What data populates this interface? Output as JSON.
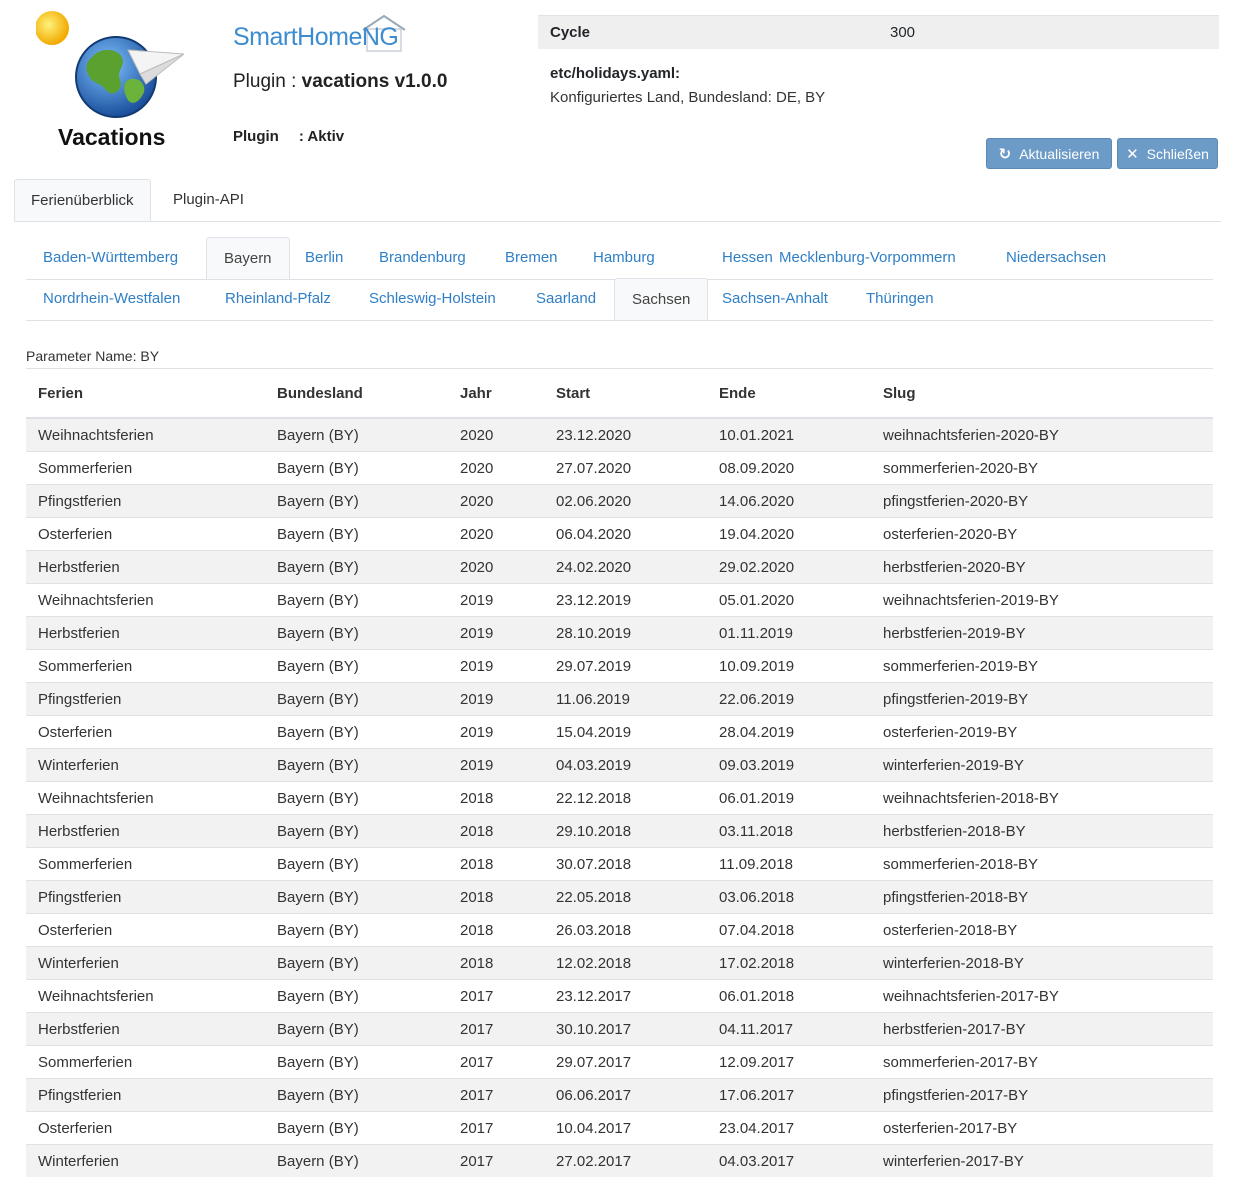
{
  "plugin_logo_name": "Vacations",
  "brand": "SmartHomeNG",
  "plugin_title_prefix": "Plugin : ",
  "plugin_title_name": "vacations v1.0.0",
  "plugin_state_label": "Plugin",
  "plugin_state_value": ": Aktiv",
  "info": {
    "cycle_label": "Cycle",
    "cycle_value": "300",
    "holidays_label": "etc/holidays.yaml:",
    "holidays_value": "Konfiguriertes Land, Bundesland: DE, BY"
  },
  "buttons": {
    "refresh": "Aktualisieren",
    "close": "Schließen"
  },
  "main_tabs": [
    "Ferienüberblick",
    "Plugin-API"
  ],
  "state_tabs_row1": [
    "Baden-Württemberg",
    "Bayern",
    "Berlin",
    "Brandenburg",
    "Bremen",
    "Hamburg",
    "Hessen",
    "Mecklenburg-Vorpommern",
    "Niedersachsen"
  ],
  "state_tabs_row2": [
    "Nordrhein-Westfalen",
    "Rheinland-Pfalz",
    "Schleswig-Holstein",
    "Saarland",
    "Sachsen",
    "Sachsen-Anhalt",
    "Thüringen"
  ],
  "param_name": "Parameter Name: BY",
  "table": {
    "headers": [
      "Ferien",
      "Bundesland",
      "Jahr",
      "Start",
      "Ende",
      "Slug"
    ],
    "rows": [
      [
        "Weihnachtsferien",
        "Bayern (BY)",
        "2020",
        "23.12.2020",
        "10.01.2021",
        "weihnachtsferien-2020-BY"
      ],
      [
        "Sommerferien",
        "Bayern (BY)",
        "2020",
        "27.07.2020",
        "08.09.2020",
        "sommerferien-2020-BY"
      ],
      [
        "Pfingstferien",
        "Bayern (BY)",
        "2020",
        "02.06.2020",
        "14.06.2020",
        "pfingstferien-2020-BY"
      ],
      [
        "Osterferien",
        "Bayern (BY)",
        "2020",
        "06.04.2020",
        "19.04.2020",
        "osterferien-2020-BY"
      ],
      [
        "Herbstferien",
        "Bayern (BY)",
        "2020",
        "24.02.2020",
        "29.02.2020",
        "herbstferien-2020-BY"
      ],
      [
        "Weihnachtsferien",
        "Bayern (BY)",
        "2019",
        "23.12.2019",
        "05.01.2020",
        "weihnachtsferien-2019-BY"
      ],
      [
        "Herbstferien",
        "Bayern (BY)",
        "2019",
        "28.10.2019",
        "01.11.2019",
        "herbstferien-2019-BY"
      ],
      [
        "Sommerferien",
        "Bayern (BY)",
        "2019",
        "29.07.2019",
        "10.09.2019",
        "sommerferien-2019-BY"
      ],
      [
        "Pfingstferien",
        "Bayern (BY)",
        "2019",
        "11.06.2019",
        "22.06.2019",
        "pfingstferien-2019-BY"
      ],
      [
        "Osterferien",
        "Bayern (BY)",
        "2019",
        "15.04.2019",
        "28.04.2019",
        "osterferien-2019-BY"
      ],
      [
        "Winterferien",
        "Bayern (BY)",
        "2019",
        "04.03.2019",
        "09.03.2019",
        "winterferien-2019-BY"
      ],
      [
        "Weihnachtsferien",
        "Bayern (BY)",
        "2018",
        "22.12.2018",
        "06.01.2019",
        "weihnachtsferien-2018-BY"
      ],
      [
        "Herbstferien",
        "Bayern (BY)",
        "2018",
        "29.10.2018",
        "03.11.2018",
        "herbstferien-2018-BY"
      ],
      [
        "Sommerferien",
        "Bayern (BY)",
        "2018",
        "30.07.2018",
        "11.09.2018",
        "sommerferien-2018-BY"
      ],
      [
        "Pfingstferien",
        "Bayern (BY)",
        "2018",
        "22.05.2018",
        "03.06.2018",
        "pfingstferien-2018-BY"
      ],
      [
        "Osterferien",
        "Bayern (BY)",
        "2018",
        "26.03.2018",
        "07.04.2018",
        "osterferien-2018-BY"
      ],
      [
        "Winterferien",
        "Bayern (BY)",
        "2018",
        "12.02.2018",
        "17.02.2018",
        "winterferien-2018-BY"
      ],
      [
        "Weihnachtsferien",
        "Bayern (BY)",
        "2017",
        "23.12.2017",
        "06.01.2018",
        "weihnachtsferien-2017-BY"
      ],
      [
        "Herbstferien",
        "Bayern (BY)",
        "2017",
        "30.10.2017",
        "04.11.2017",
        "herbstferien-2017-BY"
      ],
      [
        "Sommerferien",
        "Bayern (BY)",
        "2017",
        "29.07.2017",
        "12.09.2017",
        "sommerferien-2017-BY"
      ],
      [
        "Pfingstferien",
        "Bayern (BY)",
        "2017",
        "06.06.2017",
        "17.06.2017",
        "pfingstferien-2017-BY"
      ],
      [
        "Osterferien",
        "Bayern (BY)",
        "2017",
        "10.04.2017",
        "23.04.2017",
        "osterferien-2017-BY"
      ],
      [
        "Winterferien",
        "Bayern (BY)",
        "2017",
        "27.02.2017",
        "04.03.2017",
        "winterferien-2017-BY"
      ]
    ]
  }
}
